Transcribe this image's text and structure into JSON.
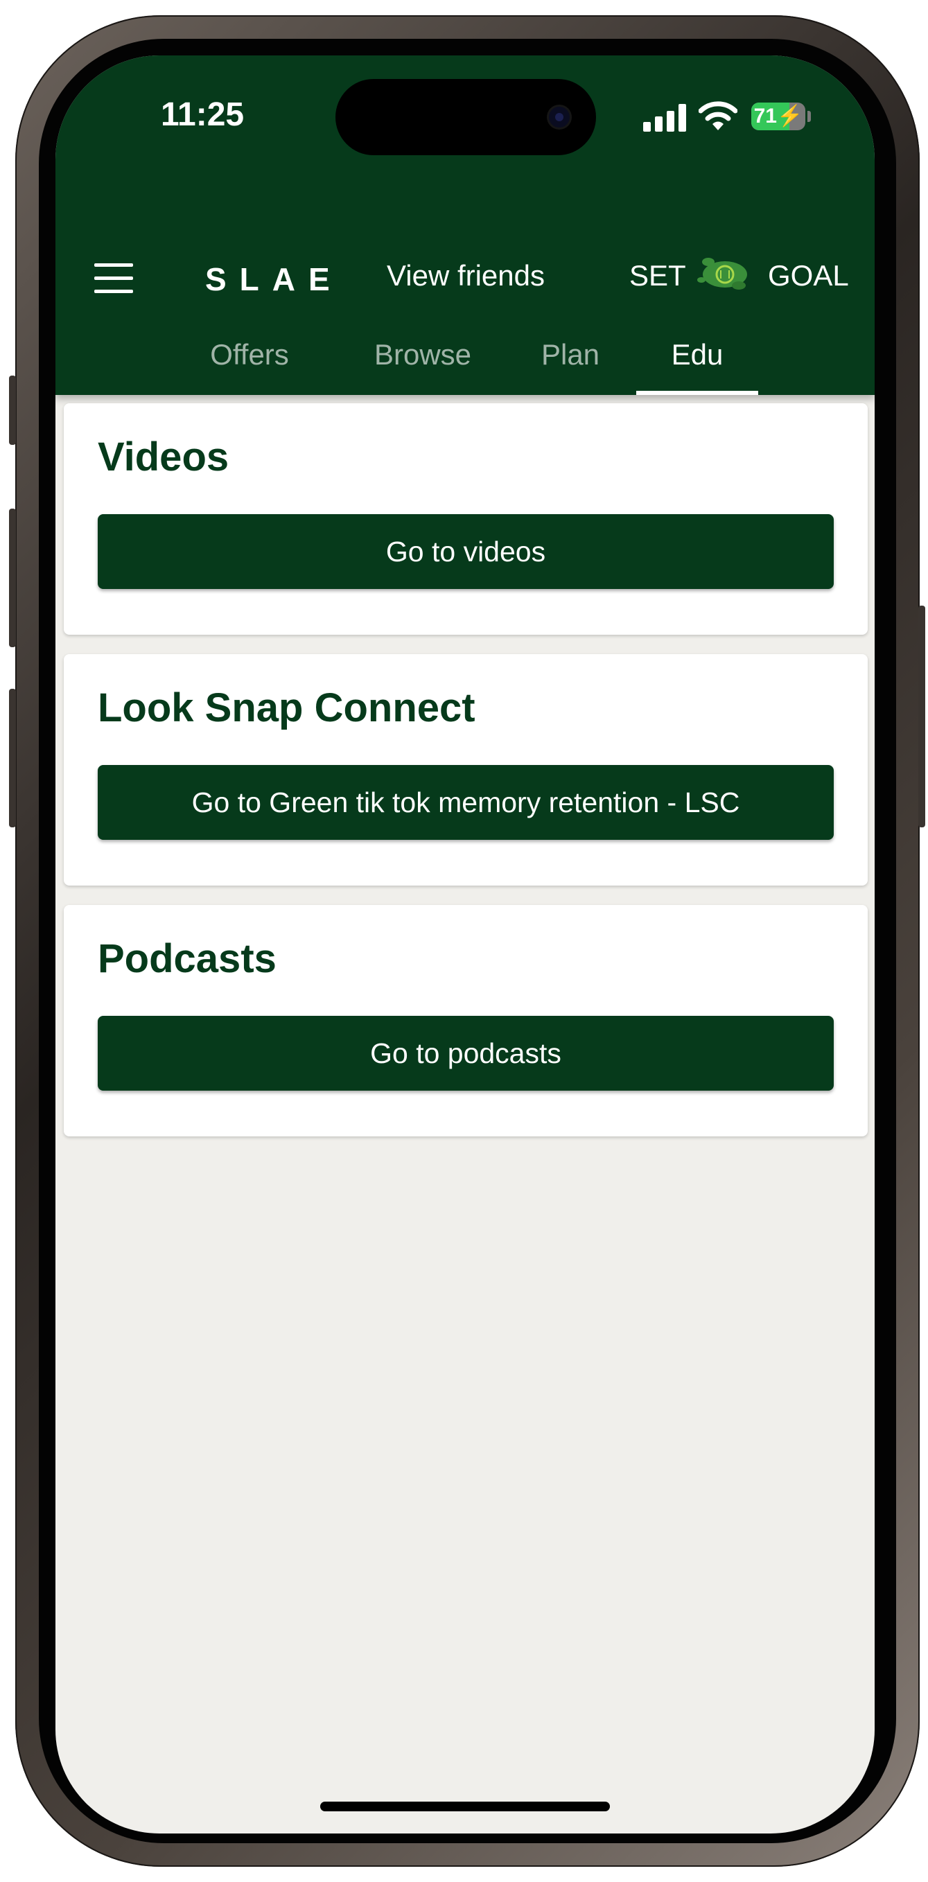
{
  "status_bar": {
    "time": "11:25",
    "battery": "71",
    "battery_level": 0.71
  },
  "header": {
    "brand": "SLAE",
    "view_friends": "View friends",
    "set_label": "SET",
    "goal_label": "GOAL",
    "logo_icon": "leaf-co-icon",
    "menu_icon": "hamburger-menu-icon"
  },
  "tabs": [
    {
      "label": "Offers",
      "active": false
    },
    {
      "label": "Browse",
      "active": false
    },
    {
      "label": "Plan",
      "active": false
    },
    {
      "label": "Edu",
      "active": true
    }
  ],
  "cards": [
    {
      "title": "Videos",
      "button": "Go to videos"
    },
    {
      "title": "Look Snap Connect",
      "button": "Go to Green tik tok memory retention - LSC"
    },
    {
      "title": "Podcasts",
      "button": "Go to podcasts"
    }
  ],
  "colors": {
    "brand_green": "#063a1b",
    "background": "#f0efeb",
    "leaf_green": "#3a8f3a"
  }
}
